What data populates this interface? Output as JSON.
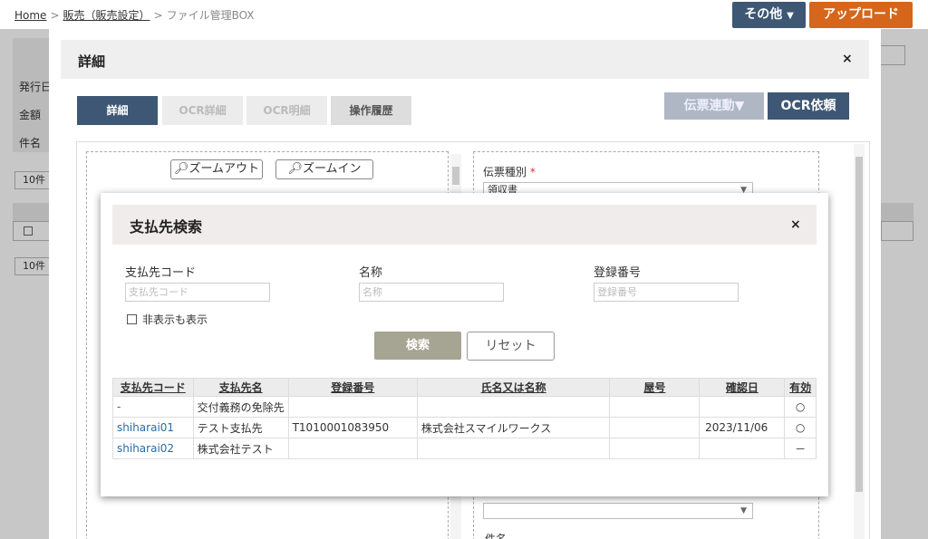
{
  "header": {
    "breadcrumb": {
      "home": "Home",
      "sales": "販売（販売設定）",
      "current": "ファイル管理BOX"
    },
    "other_button": "その他",
    "upload_button": "アップロード"
  },
  "background": {
    "labels": [
      "発行日",
      "金額",
      "件名"
    ],
    "page_size_1": "10件",
    "page_size_2": "10件"
  },
  "detail_modal": {
    "title": "詳細",
    "close": "×",
    "tabs": [
      "詳細",
      "OCR詳細",
      "OCR明細",
      "操作履歴"
    ],
    "denpyo_button": "伝票連動▼",
    "ocr_button": "OCR依頼",
    "zoom_out": "ズームアウト",
    "zoom_in": "ズームイン",
    "denpyo_type_label": "伝票種別",
    "required_mark": "*",
    "denpyo_type_value": "領収書",
    "subject_label": "件名"
  },
  "search_modal": {
    "title": "支払先検索",
    "close": "×",
    "fields": {
      "code_label": "支払先コード",
      "code_placeholder": "支払先コード",
      "name_label": "名称",
      "name_placeholder": "名称",
      "reg_label": "登録番号",
      "reg_placeholder": "登録番号"
    },
    "show_hidden_label": "非表示も表示",
    "search_button": "検索",
    "reset_button": "リセット",
    "table": {
      "headers": [
        "支払先コード",
        "支払先名",
        "登録番号",
        "氏名又は名称",
        "屋号",
        "確認日",
        "有効"
      ],
      "rows": [
        {
          "code": "-",
          "name": "交付義務の免除先",
          "reg": "",
          "fullname": "",
          "yago": "",
          "date": "",
          "valid": "○"
        },
        {
          "code": "shiharai01",
          "name": "テスト支払先",
          "reg": "T1010001083950",
          "fullname": "株式会社スマイルワークス",
          "yago": "",
          "date": "2023/11/06",
          "valid": "○"
        },
        {
          "code": "shiharai02",
          "name": "株式会社テスト",
          "reg": "",
          "fullname": "",
          "yago": "",
          "date": "",
          "valid": "－"
        }
      ]
    }
  }
}
